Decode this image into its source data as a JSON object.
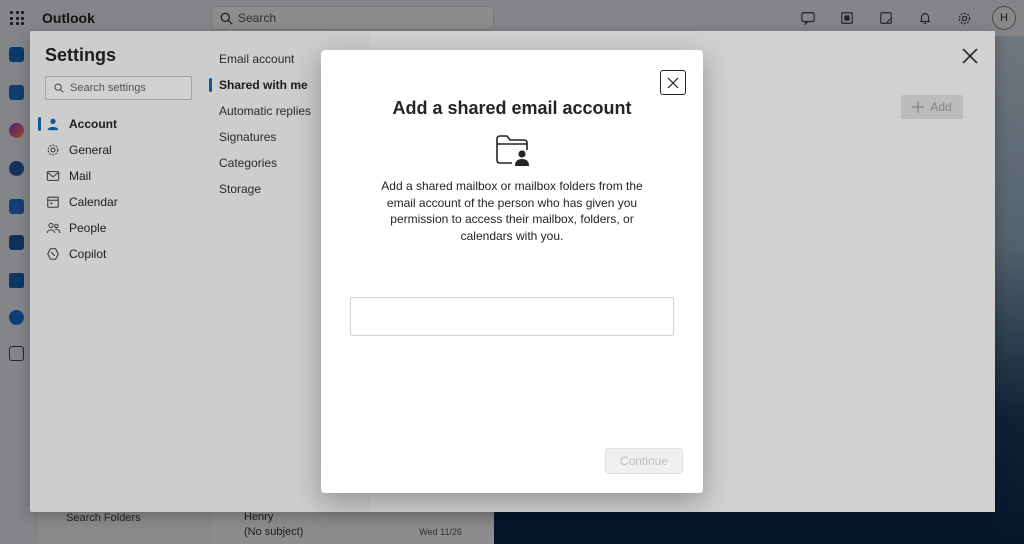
{
  "app": {
    "title": "Outlook"
  },
  "search": {
    "placeholder": "Search"
  },
  "topbar": {
    "avatar_initial": "H"
  },
  "background": {
    "folder_item": "Search Folders",
    "mail_sender": "Henry",
    "mail_subject": "(No subject)",
    "mail_date": "Wed 11/26"
  },
  "settings": {
    "title": "Settings",
    "search_placeholder": "Search settings",
    "categories": [
      {
        "label": "Account",
        "icon": "person-icon",
        "active": true
      },
      {
        "label": "General",
        "icon": "gear-icon"
      },
      {
        "label": "Mail",
        "icon": "mail-icon"
      },
      {
        "label": "Calendar",
        "icon": "calendar-icon"
      },
      {
        "label": "People",
        "icon": "people-icon"
      },
      {
        "label": "Copilot",
        "icon": "copilot-icon"
      }
    ],
    "subcategories": [
      {
        "label": "Email account"
      },
      {
        "label": "Shared with me",
        "active": true
      },
      {
        "label": "Automatic replies"
      },
      {
        "label": "Signatures"
      },
      {
        "label": "Categories"
      },
      {
        "label": "Storage"
      }
    ],
    "add_label": "Add"
  },
  "dialog": {
    "title": "Add a shared email account",
    "icon": "folder-person-icon",
    "description": "Add a shared mailbox or mailbox folders from the email account of the person who has given you permission to access their mailbox, folders, or calendars with you.",
    "input_value": "",
    "continue_label": "Continue"
  },
  "colors": {
    "accent": "#0f6cbd"
  }
}
